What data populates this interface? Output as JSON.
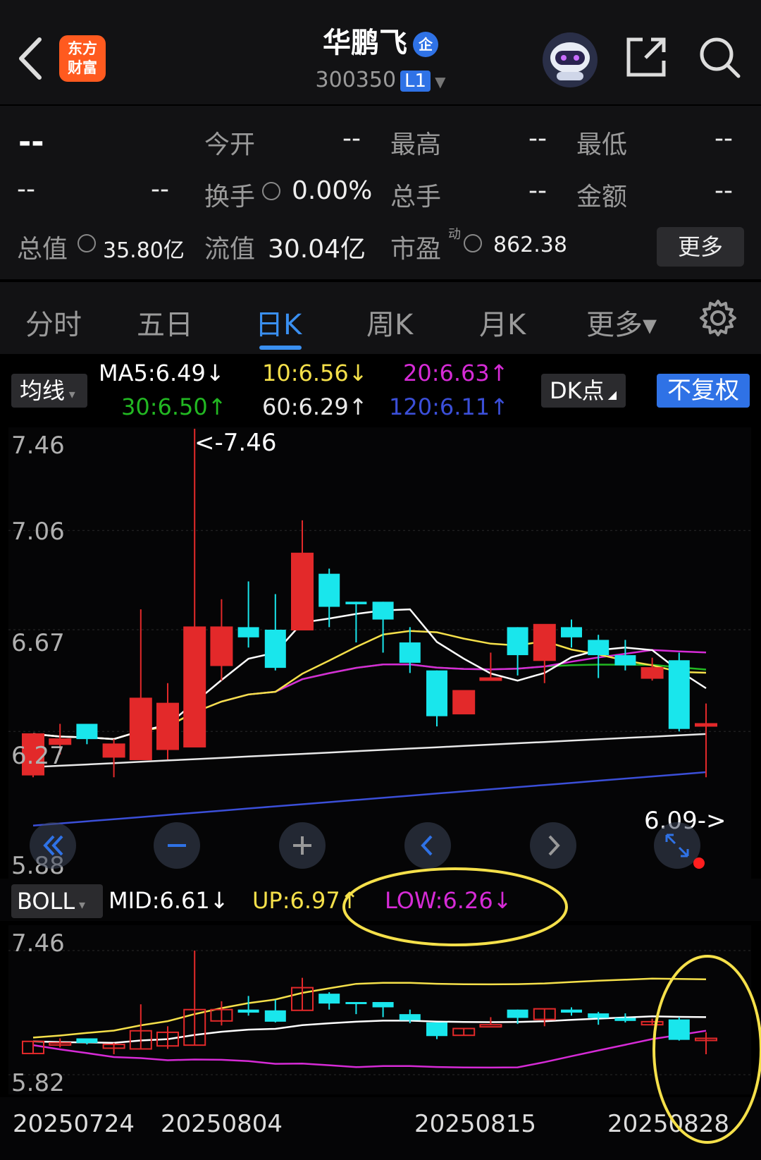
{
  "header": {
    "logo_line1": "东方",
    "logo_line2": "财富",
    "stock_name": "华鹏飞",
    "badge": "企",
    "stock_code": "300350",
    "level": "L1"
  },
  "quote": {
    "price": "--",
    "change": "--",
    "change_pct": "--",
    "open_label": "今开",
    "open_value": "--",
    "high_label": "最高",
    "high_value": "--",
    "low_label": "最低",
    "low_value": "--",
    "turnover_label": "换手",
    "turnover_value": "0.00%",
    "volume_label": "总手",
    "volume_value": "--",
    "amount_label": "金额",
    "amount_value": "--",
    "total_mv_label": "总值",
    "total_mv_value": "35.80亿",
    "float_mv_label": "流值",
    "float_mv_value": "30.04亿",
    "pe_label": "市盈",
    "pe_sup": "动",
    "pe_value": "862.38",
    "more_label": "更多"
  },
  "tabs": [
    {
      "label": "分时"
    },
    {
      "label": "五日"
    },
    {
      "label": "日K"
    },
    {
      "label": "周K"
    },
    {
      "label": "月K"
    },
    {
      "label": "更多▾"
    }
  ],
  "legend": {
    "ma_select": "均线",
    "ma5": "MA5:6.49↓",
    "ma10": "10:6.56↓",
    "ma20": "20:6.63↑",
    "ma30": "30:6.50↑",
    "ma60": "60:6.29↑",
    "ma120": "120:6.11↑",
    "dk_label": "DK点",
    "adj_label": "不复权",
    "colors": {
      "ma5": "#ffffff",
      "ma10": "#f5e04a",
      "ma20": "#d62bd6",
      "ma30": "#22b822",
      "ma60": "#e8e8e8",
      "ma120": "#3b4fd8",
      "up": "#e3292a",
      "down": "#19e6ec"
    }
  },
  "main_chart": {
    "ytick_labels": [
      "7.46",
      "7.06",
      "6.67",
      "6.27",
      "5.88"
    ],
    "max_label": "<-7.46",
    "min_label": "6.09->"
  },
  "boll": {
    "select": "BOLL",
    "mid": "MID:6.61↓",
    "up": "UP:6.97↑",
    "low": "LOW:6.26↓",
    "ytick_labels": [
      "7.46",
      "5.82"
    ]
  },
  "x_dates": [
    "20250724",
    "20250804",
    "20250815",
    "20250828"
  ],
  "chart_data": {
    "type": "candlestick",
    "ylim": [
      5.88,
      7.46
    ],
    "candles": [
      {
        "o": 6.1,
        "h": 6.26,
        "l": 6.09,
        "c": 6.26
      },
      {
        "o": 6.22,
        "h": 6.3,
        "l": 6.18,
        "c": 6.24
      },
      {
        "o": 6.3,
        "h": 6.3,
        "l": 6.22,
        "c": 6.24
      },
      {
        "o": 6.17,
        "h": 6.24,
        "l": 6.09,
        "c": 6.22
      },
      {
        "o": 6.16,
        "h": 6.75,
        "l": 6.16,
        "c": 6.4
      },
      {
        "o": 6.2,
        "h": 6.46,
        "l": 6.16,
        "c": 6.38
      },
      {
        "o": 6.21,
        "h": 7.46,
        "l": 6.21,
        "c": 6.68
      },
      {
        "o": 6.53,
        "h": 6.79,
        "l": 6.47,
        "c": 6.68
      },
      {
        "o": 6.68,
        "h": 6.86,
        "l": 6.6,
        "c": 6.64
      },
      {
        "o": 6.67,
        "h": 6.81,
        "l": 6.51,
        "c": 6.52
      },
      {
        "o": 6.67,
        "h": 7.1,
        "l": 6.67,
        "c": 6.97
      },
      {
        "o": 6.89,
        "h": 6.91,
        "l": 6.68,
        "c": 6.76
      },
      {
        "o": 6.78,
        "h": 6.78,
        "l": 6.62,
        "c": 6.77
      },
      {
        "o": 6.78,
        "h": 6.78,
        "l": 6.58,
        "c": 6.71
      },
      {
        "o": 6.62,
        "h": 6.68,
        "l": 6.5,
        "c": 6.54
      },
      {
        "o": 6.51,
        "h": 6.51,
        "l": 6.29,
        "c": 6.33
      },
      {
        "o": 6.34,
        "h": 6.43,
        "l": 6.34,
        "c": 6.43
      },
      {
        "o": 6.48,
        "h": 6.58,
        "l": 6.48,
        "c": 6.48
      },
      {
        "o": 6.68,
        "h": 6.68,
        "l": 6.49,
        "c": 6.57
      },
      {
        "o": 6.55,
        "h": 6.69,
        "l": 6.46,
        "c": 6.69
      },
      {
        "o": 6.68,
        "h": 6.71,
        "l": 6.6,
        "c": 6.64
      },
      {
        "o": 6.63,
        "h": 6.65,
        "l": 6.48,
        "c": 6.57
      },
      {
        "o": 6.57,
        "h": 6.63,
        "l": 6.51,
        "c": 6.53
      },
      {
        "o": 6.48,
        "h": 6.56,
        "l": 6.47,
        "c": 6.52
      },
      {
        "o": 6.55,
        "h": 6.58,
        "l": 6.27,
        "c": 6.28
      },
      {
        "o": 6.3,
        "h": 6.38,
        "l": 6.09,
        "c": 6.3
      }
    ]
  }
}
